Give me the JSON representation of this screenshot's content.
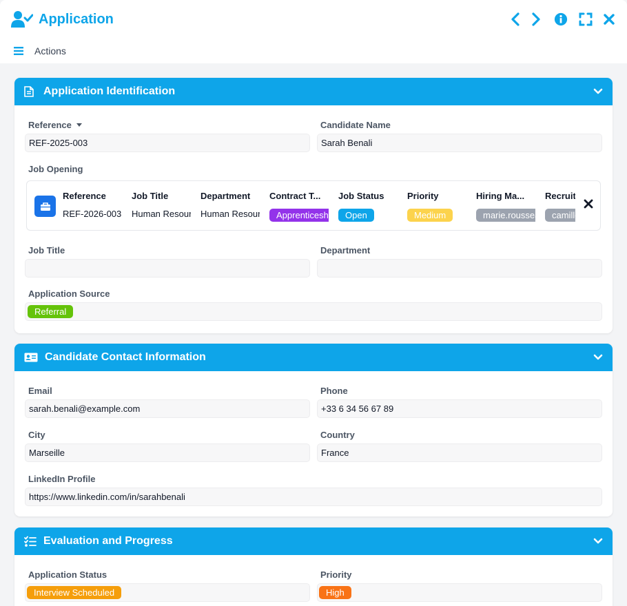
{
  "window": {
    "title": "Application"
  },
  "menu": {
    "actions_label": "Actions"
  },
  "sections": {
    "identification": {
      "title": "Application Identification",
      "reference_label": "Reference",
      "reference_value": "REF-2025-003",
      "candidate_label": "Candidate Name",
      "candidate_value": "Sarah Benali",
      "job_opening_label": "Job Opening",
      "job_opening": {
        "columns": [
          "Reference",
          "Job Title",
          "Department",
          "Contract T...",
          "Job Status",
          "Priority",
          "Hiring Ma...",
          "Recruit"
        ],
        "reference": "REF-2026-003",
        "job_title": "Human Resources",
        "department": "Human Resources",
        "contract_type": "Apprenticeship",
        "job_status": "Open",
        "priority": "Medium",
        "hiring_manager": "marie.rousseau",
        "recruiter": "camille"
      },
      "job_title_label": "Job Title",
      "job_title_value": "",
      "department_label": "Department",
      "department_value": "",
      "source_label": "Application Source",
      "source_value": "Referral"
    },
    "contact": {
      "title": "Candidate Contact Information",
      "email_label": "Email",
      "email_value": "sarah.benali@example.com",
      "phone_label": "Phone",
      "phone_value": "+33 6 34 56 67 89",
      "city_label": "City",
      "city_value": "Marseille",
      "country_label": "Country",
      "country_value": "France",
      "linkedin_label": "LinkedIn Profile",
      "linkedin_value": "https://www.linkedin.com/in/sarahbenali"
    },
    "evaluation": {
      "title": "Evaluation and Progress",
      "status_label": "Application Status",
      "status_value": "Interview Scheduled",
      "priority_label": "Priority",
      "priority_value": "High"
    }
  },
  "colors": {
    "accent": "#0ea5e9",
    "apprenticeship": "#9333ea",
    "open": "#0ea5e9",
    "medium": "#facc15",
    "user_tag": "#9ca3af",
    "referral": "#65c30a",
    "interview": "#f59e0b",
    "high": "#f97316"
  },
  "icons": {
    "title": "user-check-icon",
    "prev": "chevron-left-icon",
    "next": "chevron-right-icon",
    "info": "info-icon",
    "expand": "expand-icon",
    "close": "close-icon",
    "menu": "hamburger-icon"
  }
}
